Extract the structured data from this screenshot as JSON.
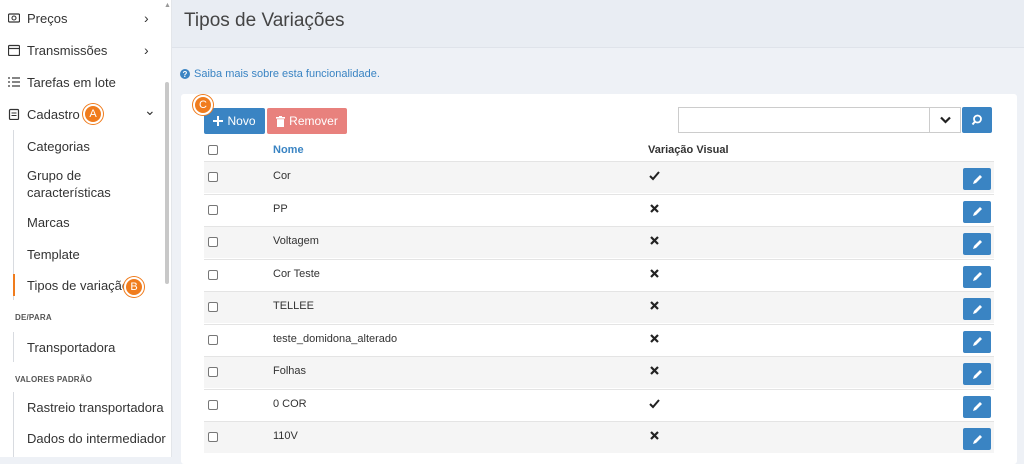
{
  "sidebar": {
    "items": [
      {
        "label": "Preços",
        "icon": "price-tag-icon",
        "has_chevron": true,
        "chevron": "›"
      },
      {
        "label": "Transmissões",
        "icon": "calendar-icon",
        "has_chevron": true,
        "chevron": "›"
      },
      {
        "label": "Tarefas em lote",
        "icon": "list-icon"
      },
      {
        "label": "Cadastro",
        "icon": "clipboard-icon",
        "badge": "A",
        "chevron": "⌄"
      }
    ],
    "cadastro_sub": [
      "Categorias",
      "Grupo de características",
      "Marcas",
      "Template",
      "Tipos de variação"
    ],
    "active_badge": "B",
    "section_depara": "DE/PARA",
    "depara_items": [
      "Transportadora"
    ],
    "section_valores": "VALORES PADRÃO",
    "valores_items": [
      "Rastreio transportadora",
      "Dados do intermediador"
    ]
  },
  "header": {
    "title": "Tipos de Variações"
  },
  "info_link": "Saiba mais sobre esta funcionalidade.",
  "toolbar": {
    "badge": "C",
    "novo_label": "Novo",
    "remover_label": "Remover",
    "search_placeholder": ""
  },
  "table": {
    "columns": {
      "name": "Nome",
      "visual": "Variação Visual"
    },
    "rows": [
      {
        "name": "Cor",
        "visual": true
      },
      {
        "name": "PP",
        "visual": false
      },
      {
        "name": "Voltagem",
        "visual": false
      },
      {
        "name": "Cor Teste",
        "visual": false
      },
      {
        "name": "TELLEE",
        "visual": false
      },
      {
        "name": "teste_domidona_alterado",
        "visual": false
      },
      {
        "name": "Folhas",
        "visual": false
      },
      {
        "name": "0 COR",
        "visual": true
      },
      {
        "name": "110V",
        "visual": false
      }
    ]
  },
  "colors": {
    "accent": "#3a84c3",
    "badge": "#f07c1d",
    "danger": "#e8817d"
  }
}
